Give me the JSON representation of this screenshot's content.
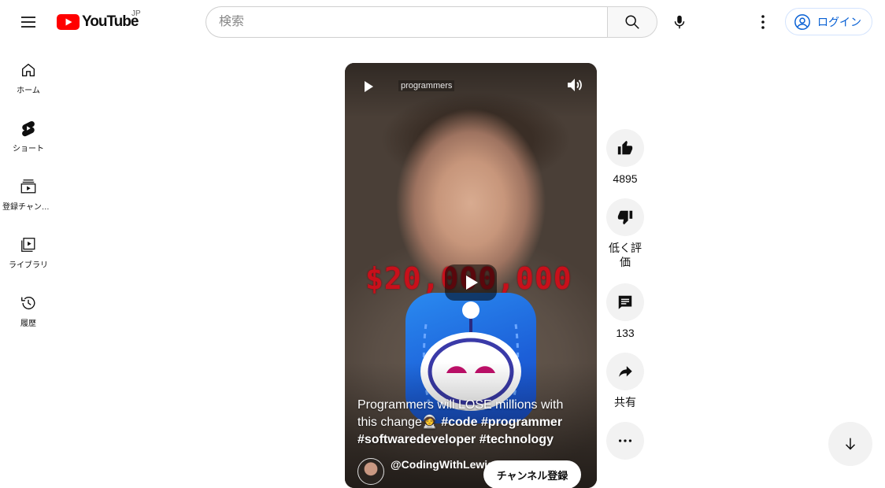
{
  "header": {
    "logo_text": "YouTube",
    "region": "JP",
    "search_placeholder": "検索",
    "login_label": "ログイン"
  },
  "sidebar": {
    "items": [
      {
        "label": "ホーム",
        "icon": "home-icon"
      },
      {
        "label": "ショート",
        "icon": "shorts-icon"
      },
      {
        "label": "登録チャンネル",
        "icon": "subscriptions-icon"
      },
      {
        "label": "ライブラリ",
        "icon": "library-icon"
      },
      {
        "label": "履歴",
        "icon": "history-icon"
      }
    ]
  },
  "video": {
    "channel_tag": "programmers",
    "overlay_text": "$20,000,000",
    "title_plain": "Programmers will LOSE millions with this change🧑‍🚀",
    "title_tags": "#code #programmer #softwaredeveloper #technology",
    "channel_name": "@CodingWithLewis",
    "subscribe_label": "チャンネル登録"
  },
  "actions": {
    "like_count": "4895",
    "dislike_label": "低く評価",
    "comment_count": "133",
    "share_label": "共有"
  },
  "colors": {
    "brand_red": "#ff0000",
    "link_blue": "#065fd4"
  }
}
